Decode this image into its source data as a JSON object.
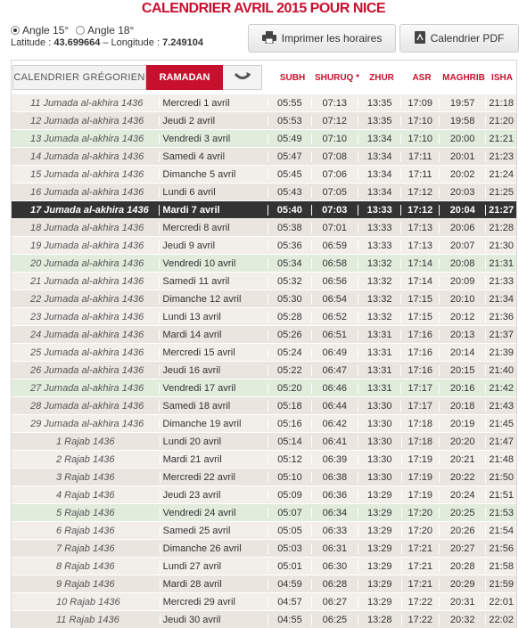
{
  "page_title": "CALENDRIER AVRIL 2015 POUR NICE",
  "angles": [
    {
      "label": "Angle 15°",
      "selected": true
    },
    {
      "label": "Angle 18°",
      "selected": false
    }
  ],
  "coords": {
    "lat_label": "Latitude : ",
    "lat_value": "43.699664",
    "sep": " – Longitude : ",
    "lon_value": "7.249104"
  },
  "buttons": {
    "print": "Imprimer les horaires",
    "pdf": "Calendrier PDF"
  },
  "tabs": {
    "gregorian": "CALENDRIER GRÉGORIEN",
    "ramadan": "RAMADAN"
  },
  "columns": [
    "SUBH",
    "SHURUQ *",
    "ZHUR",
    "ASR",
    "MAGHRIB",
    "ISHA"
  ],
  "rows": [
    {
      "hijri": "11 Jumada al-akhira 1436",
      "greg": "Mercredi 1 avril",
      "t": [
        "05:55",
        "07:13",
        "13:35",
        "17:09",
        "19:57",
        "21:18"
      ]
    },
    {
      "hijri": "12 Jumada al-akhira 1436",
      "greg": "Jeudi 2 avril",
      "t": [
        "05:53",
        "07:12",
        "13:35",
        "17:10",
        "19:58",
        "21:20"
      ]
    },
    {
      "hijri": "13 Jumada al-akhira 1436",
      "greg": "Vendredi 3 avril",
      "t": [
        "05:49",
        "07:10",
        "13:34",
        "17:10",
        "20:00",
        "21:21"
      ],
      "friday": true
    },
    {
      "hijri": "14 Jumada al-akhira 1436",
      "greg": "Samedi 4 avril",
      "t": [
        "05:47",
        "07:08",
        "13:34",
        "17:11",
        "20:01",
        "21:23"
      ]
    },
    {
      "hijri": "15 Jumada al-akhira 1436",
      "greg": "Dimanche 5 avril",
      "t": [
        "05:45",
        "07:06",
        "13:34",
        "17:11",
        "20:02",
        "21:24"
      ]
    },
    {
      "hijri": "16 Jumada al-akhira 1436",
      "greg": "Lundi 6 avril",
      "t": [
        "05:43",
        "07:05",
        "13:34",
        "17:12",
        "20:03",
        "21:25"
      ]
    },
    {
      "hijri": "17 Jumada al-akhira 1436",
      "greg": "Mardi 7 avril",
      "t": [
        "05:40",
        "07:03",
        "13:33",
        "17:12",
        "20:04",
        "21:27"
      ],
      "today": true
    },
    {
      "hijri": "18 Jumada al-akhira 1436",
      "greg": "Mercredi 8 avril",
      "t": [
        "05:38",
        "07:01",
        "13:33",
        "17:13",
        "20:06",
        "21:28"
      ]
    },
    {
      "hijri": "19 Jumada al-akhira 1436",
      "greg": "Jeudi 9 avril",
      "t": [
        "05:36",
        "06:59",
        "13:33",
        "17:13",
        "20:07",
        "21:30"
      ]
    },
    {
      "hijri": "20 Jumada al-akhira 1436",
      "greg": "Vendredi 10 avril",
      "t": [
        "05:34",
        "06:58",
        "13:32",
        "17:14",
        "20:08",
        "21:31"
      ],
      "friday": true
    },
    {
      "hijri": "21 Jumada al-akhira 1436",
      "greg": "Samedi 11 avril",
      "t": [
        "05:32",
        "06:56",
        "13:32",
        "17:14",
        "20:09",
        "21:33"
      ]
    },
    {
      "hijri": "22 Jumada al-akhira 1436",
      "greg": "Dimanche 12 avril",
      "t": [
        "05:30",
        "06:54",
        "13:32",
        "17:15",
        "20:10",
        "21:34"
      ]
    },
    {
      "hijri": "23 Jumada al-akhira 1436",
      "greg": "Lundi 13 avril",
      "t": [
        "05:28",
        "06:52",
        "13:32",
        "17:15",
        "20:12",
        "21:36"
      ]
    },
    {
      "hijri": "24 Jumada al-akhira 1436",
      "greg": "Mardi 14 avril",
      "t": [
        "05:26",
        "06:51",
        "13:31",
        "17:16",
        "20:13",
        "21:37"
      ]
    },
    {
      "hijri": "25 Jumada al-akhira 1436",
      "greg": "Mercredi 15 avril",
      "t": [
        "05:24",
        "06:49",
        "13:31",
        "17:16",
        "20:14",
        "21:39"
      ]
    },
    {
      "hijri": "26 Jumada al-akhira 1436",
      "greg": "Jeudi 16 avril",
      "t": [
        "05:22",
        "06:47",
        "13:31",
        "17:16",
        "20:15",
        "21:40"
      ]
    },
    {
      "hijri": "27 Jumada al-akhira 1436",
      "greg": "Vendredi 17 avril",
      "t": [
        "05:20",
        "06:46",
        "13:31",
        "17:17",
        "20:16",
        "21:42"
      ],
      "friday": true
    },
    {
      "hijri": "28 Jumada al-akhira 1436",
      "greg": "Samedi 18 avril",
      "t": [
        "05:18",
        "06:44",
        "13:30",
        "17:17",
        "20:18",
        "21:43"
      ]
    },
    {
      "hijri": "29 Jumada al-akhira 1436",
      "greg": "Dimanche 19 avril",
      "t": [
        "05:16",
        "06:42",
        "13:30",
        "17:18",
        "20:19",
        "21:45"
      ]
    },
    {
      "hijri": "1 Rajab 1436",
      "greg": "Lundi 20 avril",
      "t": [
        "05:14",
        "06:41",
        "13:30",
        "17:18",
        "20:20",
        "21:47"
      ]
    },
    {
      "hijri": "2 Rajab 1436",
      "greg": "Mardi 21 avril",
      "t": [
        "05:12",
        "06:39",
        "13:30",
        "17:19",
        "20:21",
        "21:48"
      ]
    },
    {
      "hijri": "3 Rajab 1436",
      "greg": "Mercredi 22 avril",
      "t": [
        "05:10",
        "06:38",
        "13:30",
        "17:19",
        "20:22",
        "21:50"
      ]
    },
    {
      "hijri": "4 Rajab 1436",
      "greg": "Jeudi 23 avril",
      "t": [
        "05:09",
        "06:36",
        "13:29",
        "17:19",
        "20:24",
        "21:51"
      ]
    },
    {
      "hijri": "5 Rajab 1436",
      "greg": "Vendredi 24 avril",
      "t": [
        "05:07",
        "06:34",
        "13:29",
        "17:20",
        "20:25",
        "21:53"
      ],
      "friday": true
    },
    {
      "hijri": "6 Rajab 1436",
      "greg": "Samedi 25 avril",
      "t": [
        "05:05",
        "06:33",
        "13:29",
        "17:20",
        "20:26",
        "21:54"
      ]
    },
    {
      "hijri": "7 Rajab 1436",
      "greg": "Dimanche 26 avril",
      "t": [
        "05:03",
        "06:31",
        "13:29",
        "17:21",
        "20:27",
        "21:56"
      ]
    },
    {
      "hijri": "8 Rajab 1436",
      "greg": "Lundi 27 avril",
      "t": [
        "05:01",
        "06:30",
        "13:29",
        "17:21",
        "20:28",
        "21:58"
      ]
    },
    {
      "hijri": "9 Rajab 1436",
      "greg": "Mardi 28 avril",
      "t": [
        "04:59",
        "06:28",
        "13:29",
        "17:21",
        "20:29",
        "21:59"
      ]
    },
    {
      "hijri": "10 Rajab 1436",
      "greg": "Mercredi 29 avril",
      "t": [
        "04:57",
        "06:27",
        "13:29",
        "17:22",
        "20:31",
        "22:01"
      ]
    },
    {
      "hijri": "11 Rajab 1436",
      "greg": "Jeudi 30 avril",
      "t": [
        "04:55",
        "06:25",
        "13:28",
        "17:22",
        "20:32",
        "22:02"
      ]
    }
  ]
}
